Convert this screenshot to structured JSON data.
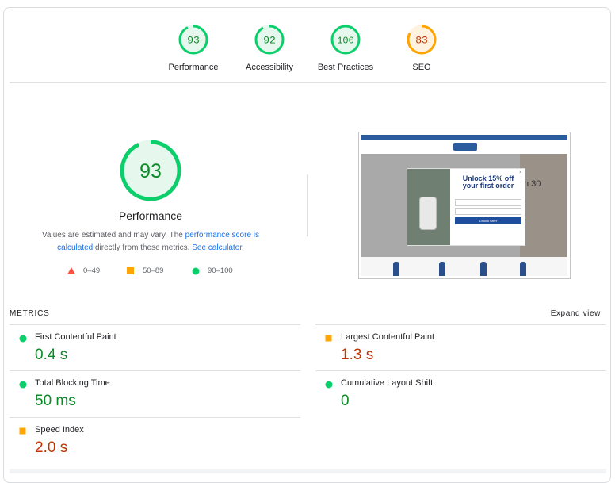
{
  "gauges": [
    {
      "label": "Performance",
      "score": "93",
      "status": "pass"
    },
    {
      "label": "Accessibility",
      "score": "92",
      "status": "pass"
    },
    {
      "label": "Best Practices",
      "score": "100",
      "status": "pass"
    },
    {
      "label": "SEO",
      "score": "83",
      "status": "average"
    }
  ],
  "main": {
    "score": "93",
    "title": "Performance",
    "desc_prefix": "Values are estimated and may vary. The ",
    "desc_link1": "performance score is calculated",
    "desc_middle": " directly from these metrics. ",
    "desc_link2": "See calculator",
    "desc_suffix": "."
  },
  "legend": [
    {
      "shape": "triangle",
      "range": "0–49"
    },
    {
      "shape": "square",
      "range": "50–89"
    },
    {
      "shape": "circle",
      "range": "90–100"
    }
  ],
  "screenshot": {
    "popup_title_1": "Unlock 15% off",
    "popup_title_2": "your first order",
    "popup_button": "Unlock Offer",
    "hero_text": "n 30"
  },
  "metrics": {
    "header": "METRICS",
    "expand_label": "Expand view",
    "items": [
      {
        "name": "First Contentful Paint",
        "value": "0.4 s",
        "status": "pass"
      },
      {
        "name": "Largest Contentful Paint",
        "value": "1.3 s",
        "status": "average"
      },
      {
        "name": "Total Blocking Time",
        "value": "50 ms",
        "status": "pass"
      },
      {
        "name": "Cumulative Layout Shift",
        "value": "0",
        "status": "pass"
      },
      {
        "name": "Speed Index",
        "value": "2.0 s",
        "status": "average"
      }
    ]
  },
  "colors": {
    "pass": "#0cce6b",
    "pass_text": "#0c8a28",
    "pass_fill": "#e6f8ed",
    "average": "#ffa400",
    "average_text": "#c33300",
    "average_fill": "#fff3e0",
    "fail": "#ff4e42",
    "link": "#1a73e8"
  }
}
